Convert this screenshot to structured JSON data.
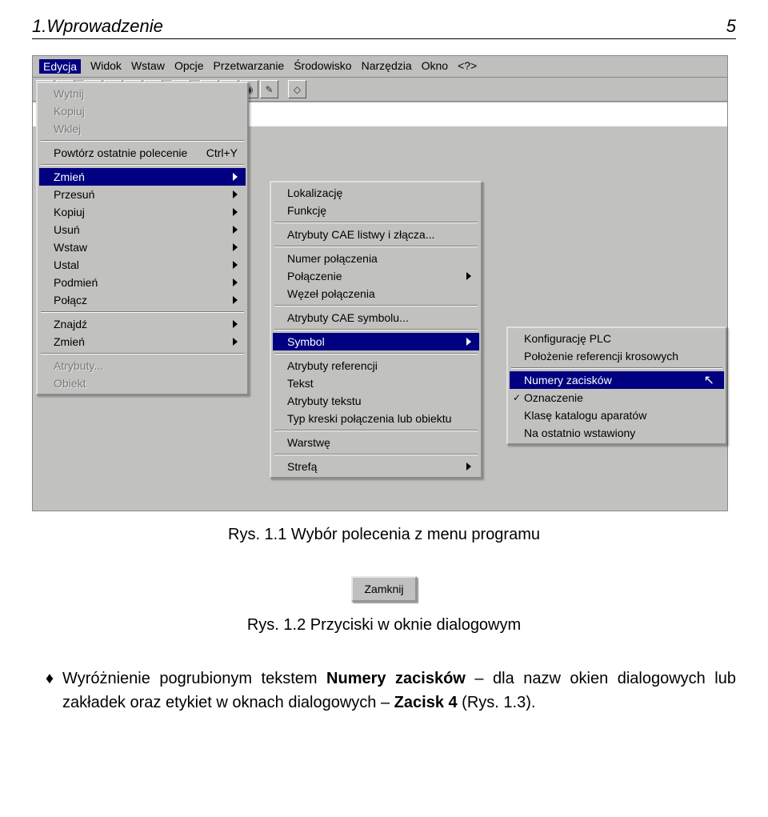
{
  "header": {
    "title": "1.Wprowadzenie",
    "page": "5"
  },
  "menubar": {
    "items": [
      "Edycja",
      "Widok",
      "Wstaw",
      "Opcje",
      "Przetwarzanie",
      "Środowisko",
      "Narzędzia",
      "Okno",
      "<?>"
    ]
  },
  "menu1": {
    "g0": [
      "Wytnij",
      "Kopiuj",
      "Wklej"
    ],
    "g1": [
      {
        "label": "Powtórz ostatnie polecenie",
        "accel": "Ctrl+Y"
      }
    ],
    "g2": [
      "Zmień",
      "Przesuń",
      "Kopiuj",
      "Usuń",
      "Wstaw",
      "Ustal",
      "Podmień",
      "Połącz"
    ],
    "g3": [
      "Znajdź",
      "Zmień"
    ],
    "g4": [
      "Atrybuty...",
      "Obiekt"
    ]
  },
  "menu2": {
    "g0": [
      "Lokalizację",
      "Funkcję"
    ],
    "g1": [
      "Atrybuty CAE listwy i złącza..."
    ],
    "g2": [
      "Numer połączenia",
      "Połączenie",
      "Węzeł połączenia"
    ],
    "g3": [
      "Atrybuty CAE symbolu..."
    ],
    "g4": [
      "Symbol"
    ],
    "g5": [
      "Atrybuty referencji",
      "Tekst",
      "Atrybuty tekstu",
      "Typ kreski połączenia lub obiektu"
    ],
    "g6": [
      "Warstwę"
    ],
    "g7": [
      "Strefą"
    ]
  },
  "menu3": {
    "g0": [
      "Konfigurację PLC",
      "Położenie referencji krosowych"
    ],
    "g1": [
      {
        "label": "Numery zacisków",
        "hl": true,
        "cursor": true
      },
      {
        "label": "Oznaczenie",
        "check": true
      },
      {
        "label": "Klasę katalogu aparatów"
      },
      {
        "label": "Na ostatnio wstawiony"
      }
    ]
  },
  "caption1": "Rys. 1.1 Wybór polecenia z menu programu",
  "button": {
    "label": "Zamknij"
  },
  "caption2": "Rys. 1.2 Przyciski w oknie dialogowym",
  "para": {
    "t1": " Wyróżnienie pogrubionym tekstem ",
    "b1": "Numery zacisków",
    "t2": " – dla nazw okien dialogowych lub zakładek oraz etykiet w oknach dialogowych – ",
    "b2": "Zacisk 4",
    "t3": " (Rys. 1.3)."
  }
}
